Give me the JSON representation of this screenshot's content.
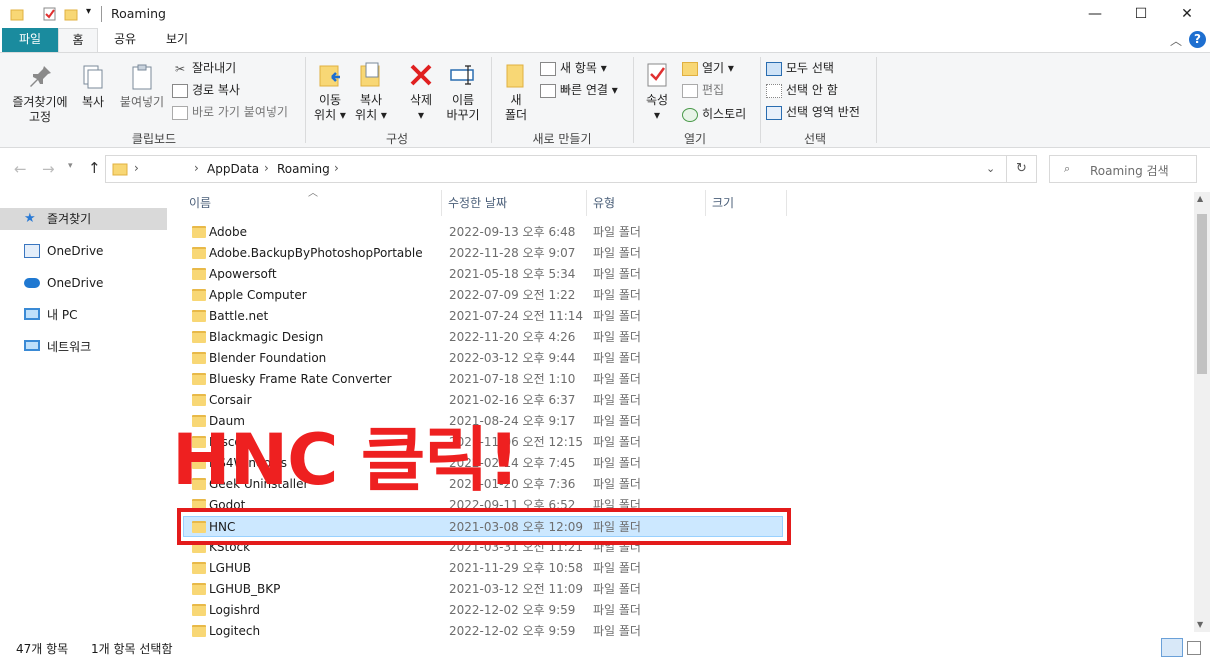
{
  "window": {
    "title": "Roaming"
  },
  "tabs": [
    {
      "label": "파일"
    },
    {
      "label": "홈"
    },
    {
      "label": "공유"
    },
    {
      "label": "보기"
    }
  ],
  "ribbon": {
    "clipboard": {
      "pin_line1": "즐겨찾기에",
      "pin_line2": "고정",
      "copy": "복사",
      "paste": "붙여넣기",
      "cut": "잘라내기",
      "copy_path": "경로 복사",
      "paste_shortcut": "바로 가기 붙여넣기",
      "label": "클립보드"
    },
    "organize": {
      "move_line1": "이동",
      "move_line2": "위치 ▾",
      "copyto_line1": "복사",
      "copyto_line2": "위치 ▾",
      "delete": "삭제",
      "delete_arrow": "▾",
      "rename_line1": "이름",
      "rename_line2": "바꾸기",
      "label": "구성"
    },
    "new": {
      "folder_line1": "새",
      "folder_line2": "폴더",
      "new_item": "새 항목 ▾",
      "easy_access": "빠른 연결 ▾",
      "label": "새로 만들기"
    },
    "open": {
      "properties": "속성",
      "properties_arrow": "▾",
      "open": "열기 ▾",
      "edit": "편집",
      "history": "히스토리",
      "label": "열기"
    },
    "select": {
      "select_all": "모두 선택",
      "select_none": "선택 안 함",
      "invert": "선택 영역 반전",
      "label": "선택"
    }
  },
  "address": {
    "crumbs": [
      "AppData",
      "Roaming"
    ],
    "search_placeholder": "Roaming 검색"
  },
  "sidebar": {
    "items": [
      {
        "label": "즐겨찾기"
      },
      {
        "label": "OneDrive"
      },
      {
        "label": "OneDrive"
      },
      {
        "label": "내 PC"
      },
      {
        "label": "네트워크"
      }
    ]
  },
  "columns": {
    "name": "이름",
    "date": "수정한 날짜",
    "type": "유형",
    "size": "크기"
  },
  "files": [
    {
      "name": "Adobe",
      "date": "2022-09-13 오후 6:48",
      "type": "파일 폴더"
    },
    {
      "name": "Adobe.BackupByPhotoshopPortable",
      "date": "2022-11-28 오후 9:07",
      "type": "파일 폴더"
    },
    {
      "name": "Apowersoft",
      "date": "2021-05-18 오후 5:34",
      "type": "파일 폴더"
    },
    {
      "name": "Apple Computer",
      "date": "2022-07-09 오전 1:22",
      "type": "파일 폴더"
    },
    {
      "name": "Battle.net",
      "date": "2021-07-24 오전 11:14",
      "type": "파일 폴더"
    },
    {
      "name": "Blackmagic Design",
      "date": "2022-11-20 오후 4:26",
      "type": "파일 폴더"
    },
    {
      "name": "Blender Foundation",
      "date": "2022-03-12 오후 9:44",
      "type": "파일 폴더"
    },
    {
      "name": "Bluesky Frame Rate Converter",
      "date": "2021-07-18 오전 1:10",
      "type": "파일 폴더"
    },
    {
      "name": "Corsair",
      "date": "2021-02-16 오후 6:37",
      "type": "파일 폴더"
    },
    {
      "name": "Daum",
      "date": "2021-08-24 오후 9:17",
      "type": "파일 폴더"
    },
    {
      "name": "Disco",
      "date": "2021-11-06 오전 12:15",
      "type": "파일 폴더"
    },
    {
      "name": "DS4Windows",
      "date": "2022-02-14 오후 7:45",
      "type": "파일 폴더"
    },
    {
      "name": "Geek Uninstaller",
      "date": "2021-01-20 오후 7:36",
      "type": "파일 폴더"
    },
    {
      "name": "Godot",
      "date": "2022-09-11 오후 6:52",
      "type": "파일 폴더"
    },
    {
      "name": "HNC",
      "date": "2021-03-08 오후 12:09",
      "type": "파일 폴더"
    },
    {
      "name": "KStock",
      "date": "2021-03-31 오전 11:21",
      "type": "파일 폴더"
    },
    {
      "name": "LGHUB",
      "date": "2021-11-29 오후 10:58",
      "type": "파일 폴더"
    },
    {
      "name": "LGHUB_BKP",
      "date": "2021-03-12 오전 11:09",
      "type": "파일 폴더"
    },
    {
      "name": "Logishrd",
      "date": "2022-12-02 오후 9:59",
      "type": "파일 폴더"
    },
    {
      "name": "Logitech",
      "date": "2022-12-02 오후 9:59",
      "type": "파일 폴더"
    }
  ],
  "status": {
    "count": "47개 항목",
    "selected": "1개 항목 선택함"
  },
  "annotation": {
    "text": "HNC 클릭!"
  },
  "colors": {
    "file_tab": "#1a8b9e",
    "selection": "#cce8ff",
    "annotation": "#ee2020"
  }
}
